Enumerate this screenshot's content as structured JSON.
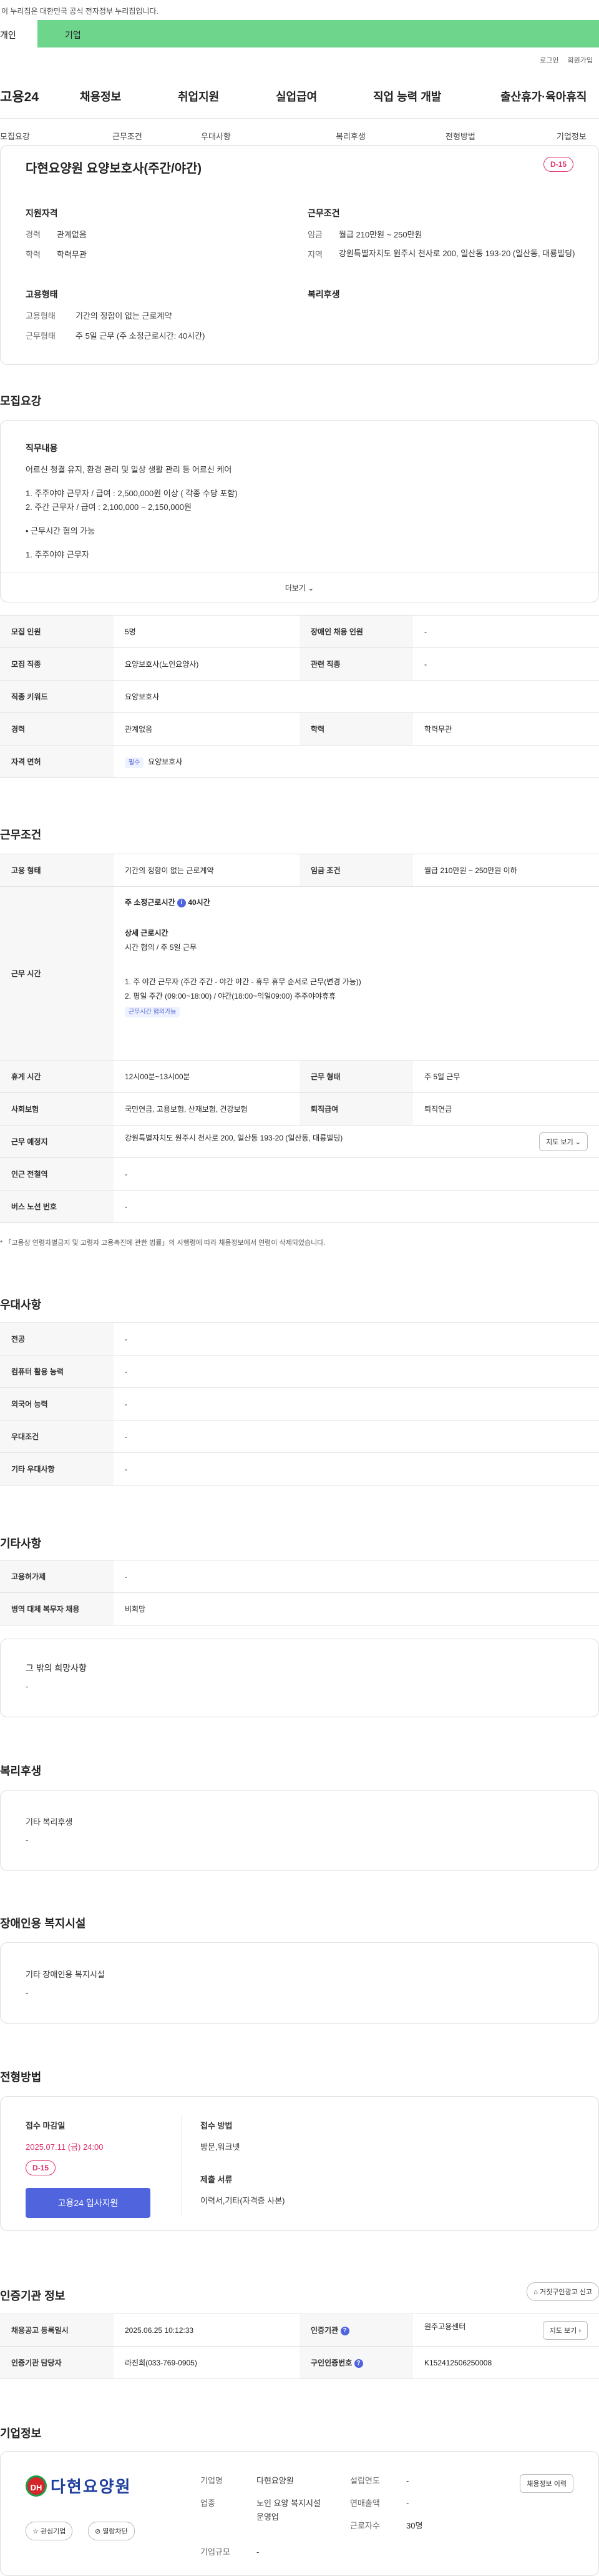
{
  "gov_banner": "이 누리집은 대한민국 공식 전자정부 누리집입니다.",
  "user_tabs": [
    "개인",
    "기업"
  ],
  "top_links": [
    "로그인",
    "회원가입"
  ],
  "gnb": {
    "logo": "고용24",
    "menus": [
      "채용정보",
      "취업지원",
      "실업급여",
      "직업 능력 개발",
      "출산휴가·육아휴직"
    ]
  },
  "lnb": [
    "모집요강",
    "근무조건",
    "우대사항",
    "복리후생",
    "전형방법",
    "기업정보"
  ],
  "job": {
    "title": "다현요양원 요양보호사(주간/야간)",
    "dday": "D-15",
    "qual_title": "지원자격",
    "qual": [
      {
        "k": "경력",
        "v": "관계없음"
      },
      {
        "k": "학력",
        "v": "학력무관"
      }
    ],
    "cond_title": "근무조건",
    "cond": [
      {
        "k": "임금",
        "v": "월급 210만원 ~ 250만원"
      },
      {
        "k": "지역",
        "v": "강원특별자치도 원주시 천사로 200, 일산동 193-20 (일산동, 대룡빌딩)"
      }
    ],
    "emp_title": "고용형태",
    "emp": [
      {
        "k": "고용형태",
        "v": "기간의 정함이 없는 근로계약"
      },
      {
        "k": "근무형태",
        "v": "주 5일 근무 (주 소정근로시간: 40시간)"
      }
    ],
    "welfare_title": "복리후생"
  },
  "recruit": {
    "title": "모집요강",
    "duty_title": "직무내용",
    "duty_lines": [
      "어르신 청결 유지, 환경 관리 및 일상 생활 관리 등 어르신 케어",
      "1. 주주야야 근무자 / 급여 : 2,500,000원 이상 ( 각종 수당 포함)",
      "2. 주간 근무자 / 급여 : 2,100,000 ~ 2,150,000원",
      "• 근무시간 협의 가능",
      "1. 주주야야 근무자"
    ],
    "more": "더보기",
    "rows": [
      {
        "k1": "모집 인원",
        "v1": "5명",
        "k2": "장애인 채용 인원",
        "v2": "-"
      },
      {
        "k1": "모집 직종",
        "v1": "요양보호사(노인요양사)",
        "k2": "관련 직종",
        "v2": "-"
      },
      {
        "k1": "직종 키워드",
        "v1": "요양보호사",
        "k2": "",
        "v2": ""
      },
      {
        "k1": "경력",
        "v1": "관계없음",
        "k2": "학력",
        "v2": "학력무관"
      },
      {
        "k1": "자격 면허",
        "v1": "요양보호사",
        "k2": "",
        "v2": ""
      }
    ],
    "license_tag": "필수"
  },
  "conditions": {
    "title": "근무조건",
    "r1": {
      "k1": "고용 형태",
      "v1": "기간의 정함이 없는 근로계약",
      "k2": "임금 조건",
      "v2": "월급 210만원 ~ 250만원 이하"
    },
    "worktime_label": "근무 시간",
    "weekly": "주 소정근로시간",
    "weekly_val": "40시간",
    "detail_title": "상세 근로시간",
    "detail_sub": "시간 협의 / 주 5일 근무",
    "detail_lines": [
      "1. 주 야간 근무자 (주간 주간 - 야간 야간 - 휴무 휴무 순서로 근무(변경 가능))",
      "2. 평일 주간 (09:00~18:00) / 야간(18:00~익일09:00) 주주야야휴휴"
    ],
    "detail_tag": "근무시간 협의가능",
    "r3": {
      "k1": "휴게 시간",
      "v1": "12시00분~13시00분",
      "k2": "근무 형태",
      "v2": "주 5일 근무"
    },
    "r4": {
      "k1": "사회보험",
      "v1": "국민연금, 고용보험, 산재보험, 건강보험",
      "k2": "퇴직급여",
      "v2": "퇴직연금"
    },
    "r5": {
      "k": "근무 예정지",
      "v": "강원특별자치도 원주시 천사로 200, 일산동 193-20 (일산동, 대룡빌딩)",
      "btn": "지도 보기"
    },
    "r6": {
      "k": "인근 전철역",
      "v": "-"
    },
    "r7": {
      "k": "버스 노선 번호",
      "v": "-"
    },
    "note": "* 「고용상 연령차별금지 및 고령자 고용촉진에 관한 법률」의 시행령에 따라 채용정보에서 연령이 삭제되었습니다."
  },
  "pref": {
    "title": "우대사항",
    "rows": [
      {
        "k": "전공",
        "v": "-"
      },
      {
        "k": "컴퓨터 활용 능력",
        "v": "-"
      },
      {
        "k": "외국어 능력",
        "v": "-"
      },
      {
        "k": "우대조건",
        "v": "-"
      },
      {
        "k": "기타 우대사항",
        "v": "-"
      }
    ]
  },
  "etc": {
    "title": "기타사항",
    "rows": [
      {
        "k": "고용허가제",
        "v": "-"
      },
      {
        "k": "병역 대체 복무자 채용",
        "v": "비희망"
      }
    ],
    "box_title": "그 밖의 희망사항",
    "box_val": "-"
  },
  "welfare": {
    "title": "복리후생",
    "box_title": "기타 복리후생",
    "box_val": "-"
  },
  "disabled": {
    "title": "장애인용 복지시설",
    "box_title": "기타 장애인용 복지시설",
    "box_val": "-"
  },
  "process": {
    "title": "전형방법",
    "deadline_label": "접수 마감일",
    "deadline": "2025.07.11 (금) 24:00",
    "dday": "D-15",
    "apply_btn": "고용24 입사지원",
    "method_label": "접수 방법",
    "method": "방문,워크넷",
    "docs_label": "제출 서류",
    "docs": "이력서,기타(자격증 사본)"
  },
  "agency": {
    "title": "인증기관 정보",
    "report_btn": "거짓구인광고 신고",
    "r1": {
      "k1": "채용공고 등록일시",
      "v1": "2025.06.25 10:12:33",
      "k2": "인증기관",
      "v2": "원주고용센터",
      "btn": "지도 보기"
    },
    "r2": {
      "k1": "인증기관 담당자",
      "v1": "라진희(033-769-0905)",
      "k2": "구인인증번호",
      "v2": "K152412506250008"
    }
  },
  "company": {
    "title": "기업정보",
    "logo_text": "다현요양원",
    "logo_mark": "DH",
    "fav_btn": "관심기업",
    "block_btn": "열람차단",
    "c1": [
      {
        "k": "기업명",
        "v": "다현요양원"
      },
      {
        "k": "업종",
        "v": "노인 요양 복지시설 운영업"
      },
      {
        "k": "기업규모",
        "v": "-"
      }
    ],
    "c2": [
      {
        "k": "설립연도",
        "v": "-"
      },
      {
        "k": "연매출액",
        "v": "-"
      },
      {
        "k": "근로자수",
        "v": "30명"
      }
    ],
    "hist_btn": "채용정보 이력"
  },
  "colors": {
    "accent": "#4f64dd",
    "dday": "#e0336b",
    "tab_green": "#6dd58c"
  }
}
